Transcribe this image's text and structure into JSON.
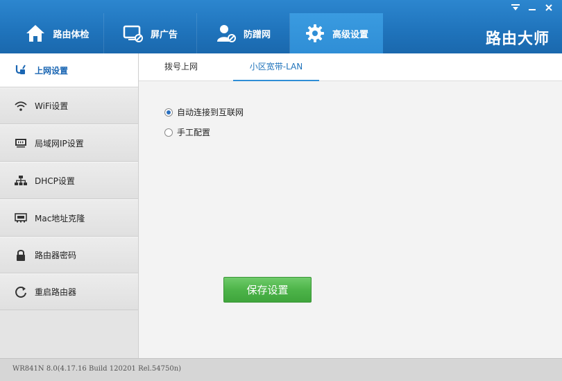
{
  "header": {
    "tabs": [
      {
        "label": "路由体检",
        "icon": "house-icon"
      },
      {
        "label": "屏广告",
        "icon": "monitor-block-icon"
      },
      {
        "label": "防蹭网",
        "icon": "user-block-icon"
      },
      {
        "label": "高级设置",
        "icon": "gear-icon",
        "active": true
      }
    ],
    "brand": "路由大师",
    "colors": {
      "bar": "#1f73bb",
      "active_tab": "#2f8ed6"
    }
  },
  "sidebar": {
    "items": [
      {
        "label": "上网设置",
        "icon": "plug-icon",
        "active": true
      },
      {
        "label": "WiFi设置",
        "icon": "wifi-icon"
      },
      {
        "label": "局域网IP设置",
        "icon": "ip-icon"
      },
      {
        "label": "DHCP设置",
        "icon": "network-tree-icon"
      },
      {
        "label": "Mac地址克隆",
        "icon": "mac-card-icon"
      },
      {
        "label": "路由器密码",
        "icon": "lock-icon"
      },
      {
        "label": "重启路由器",
        "icon": "restart-icon"
      }
    ]
  },
  "main": {
    "subtabs": [
      {
        "label": "拨号上网"
      },
      {
        "label": "小区宽带-LAN",
        "active": true
      }
    ],
    "options": [
      {
        "label": "自动连接到互联网",
        "checked": true
      },
      {
        "label": "手工配置",
        "checked": false
      }
    ],
    "save_label": "保存设置",
    "colors": {
      "save_button": "#4db449"
    }
  },
  "status": {
    "text": "WR841N 8.0(4.17.16 Build 120201 Rel.54750n)"
  }
}
